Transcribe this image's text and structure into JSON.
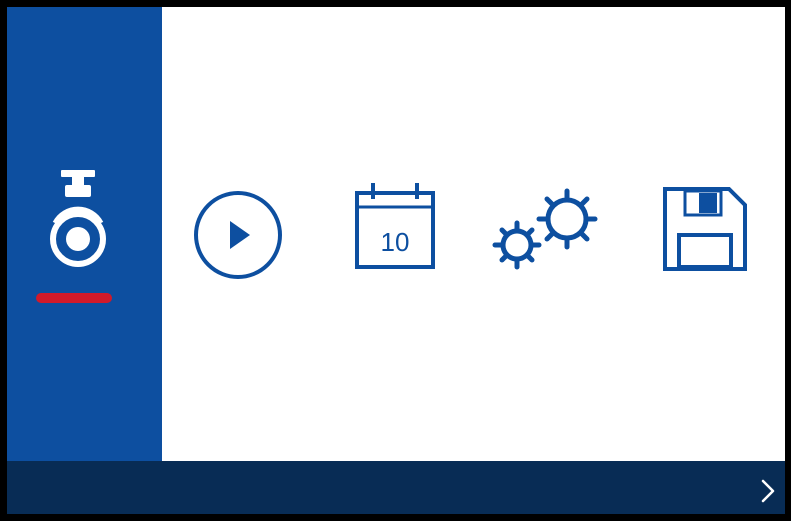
{
  "menu": {
    "selected": "camera",
    "items": [
      {
        "id": "camera",
        "icon": "dashcam-icon"
      },
      {
        "id": "playback",
        "icon": "play-icon"
      },
      {
        "id": "date",
        "icon": "calendar-icon",
        "day": "10"
      },
      {
        "id": "settings",
        "icon": "gears-icon"
      },
      {
        "id": "storage",
        "icon": "floppy-disk-icon"
      }
    ]
  },
  "bottom_bar": {
    "next_glyph": "›"
  },
  "colors": {
    "sidebar": "#0d4fa0",
    "icon_blue": "#0d4fa0",
    "selected_underline": "#d11a2a",
    "bottom_bar": "#082c55",
    "background": "#ffffff"
  }
}
